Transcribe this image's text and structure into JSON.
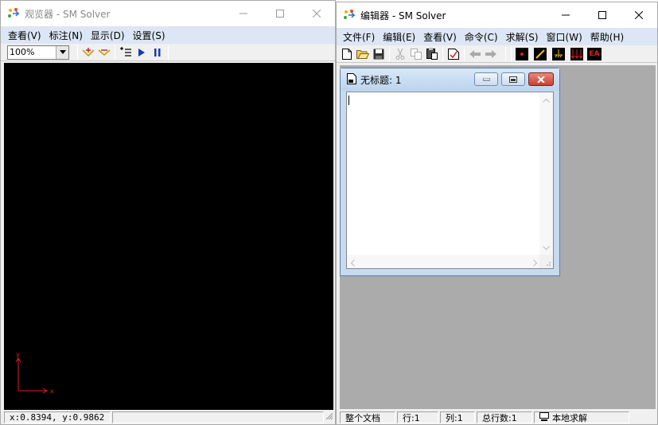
{
  "viewer": {
    "title": "观览器 - SM Solver",
    "menu": [
      "查看(V)",
      "标注(N)",
      "显示(D)",
      "设置(S)"
    ],
    "zoom": "100%",
    "axis_x": "x",
    "axis_y": "y",
    "status_coords": "x:0.8394, y:0.9862"
  },
  "editor": {
    "title": "编辑器 - SM Solver",
    "menu": [
      "文件(F)",
      "编辑(E)",
      "查看(V)",
      "命令(C)",
      "求解(S)",
      "窗口(W)",
      "帮助(H)"
    ],
    "toolbar_ea": "EA",
    "doc_title": "无标题: 1",
    "status": {
      "scope": "整个文档",
      "row": "行:1",
      "col": "列:1",
      "total": "总行数:1",
      "mode": "本地求解"
    }
  },
  "colors": {
    "menubar": "#dce6f4",
    "canvas": "#000000",
    "mdi_bg": "#ababab",
    "close_red": "#c84040"
  }
}
